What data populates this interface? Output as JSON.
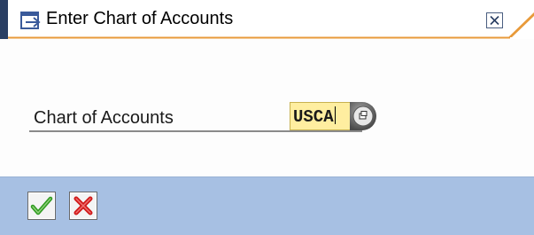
{
  "window": {
    "title": "Enter Chart of Accounts",
    "title_icon": "dialog-arrow-icon",
    "close_icon": "close-icon"
  },
  "form": {
    "chart_of_accounts_label": "Chart of Accounts",
    "chart_of_accounts_value": "USCA",
    "search_help_icon": "possible-entries-icon"
  },
  "toolbar": {
    "confirm_icon": "checkmark-icon",
    "cancel_icon": "cancel-x-icon"
  },
  "colors": {
    "title_bar": "#ffffff",
    "title_accent": "#e89a3a",
    "frame_stripe": "#5a80b4",
    "input_background": "#ffeea0",
    "footer": "#a7c0e3",
    "confirm_green": "#2e9a1f",
    "cancel_red": "#d01818"
  }
}
